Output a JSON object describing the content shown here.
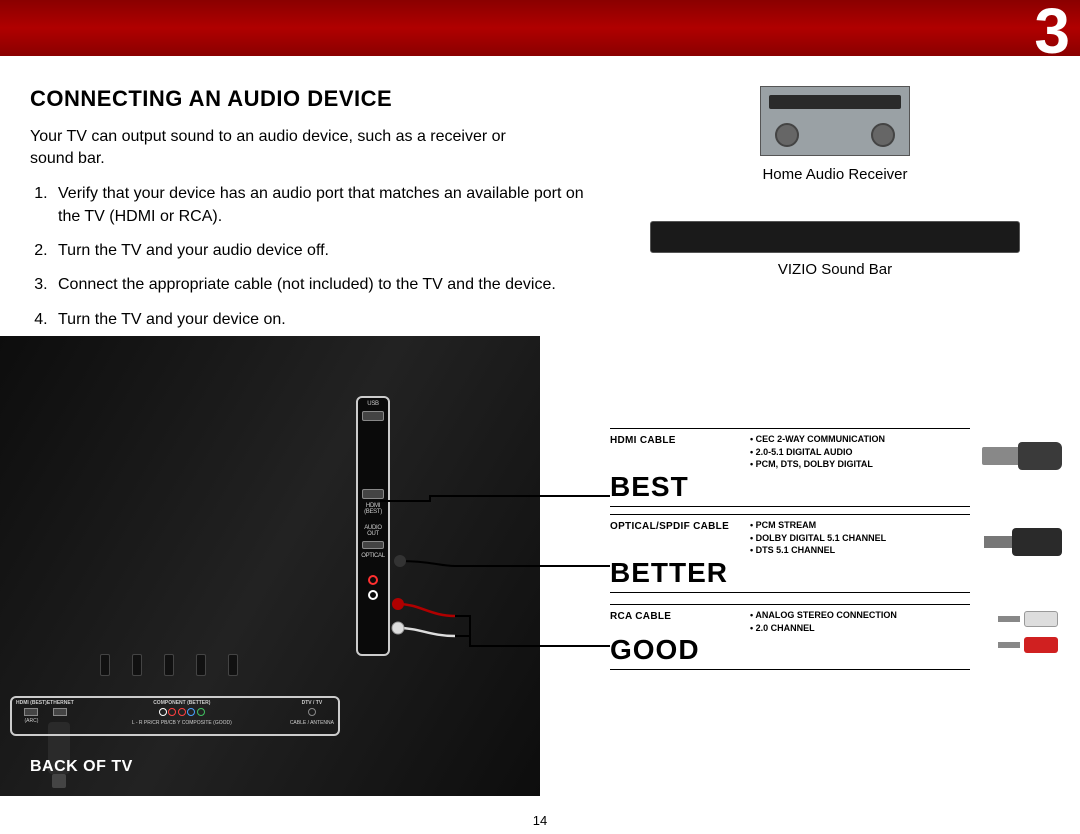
{
  "chapter_number": "3",
  "page_number": "14",
  "section_title": "CONNECTING AN AUDIO DEVICE",
  "intro_text": "Your TV can output sound to an audio device, such as a receiver or sound bar.",
  "steps": [
    "Verify that your device has an audio port that matches an available port on the TV (HDMI or RCA).",
    "Turn the TV and your audio device off.",
    "Connect the appropriate cable (not included) to the TV and the device.",
    "Turn the TV and your device on."
  ],
  "receiver_label": "Home Audio Receiver",
  "soundbar_label": "VIZIO Sound Bar",
  "back_of_tv_label": "BACK OF TV",
  "tv_side_ports": {
    "usb": "USB",
    "hdmi": "HDMI (BEST)",
    "audio_out": "AUDIO OUT",
    "optical": "OPTICAL"
  },
  "tv_bottom_ports": {
    "hdmi_best": "HDMI (BEST)",
    "arc": "(ARC)",
    "ethernet": "ETHERNET",
    "component": "COMPONENT (BETTER)",
    "component_sub": "L - R   PR/CR   PB/CB   Y   COMPOSITE (GOOD)",
    "dtv_tv": "DTV / TV",
    "dtv_sub": "CABLE / ANTENNA"
  },
  "quality": {
    "best": {
      "cable": "HDMI CABLE",
      "rank": "BEST",
      "bullets": [
        "CEC 2-WAY COMMUNICATION",
        "2.0-5.1 DIGITAL AUDIO",
        "PCM, DTS, DOLBY DIGITAL"
      ]
    },
    "better": {
      "cable": "OPTICAL/SPDIF CABLE",
      "rank": "BETTER",
      "bullets": [
        "PCM STREAM",
        "DOLBY DIGITAL 5.1 CHANNEL",
        "DTS 5.1 CHANNEL"
      ]
    },
    "good": {
      "cable": "RCA CABLE",
      "rank": "GOOD",
      "bullets": [
        "ANALOG STEREO CONNECTION",
        "2.0 CHANNEL"
      ]
    }
  }
}
